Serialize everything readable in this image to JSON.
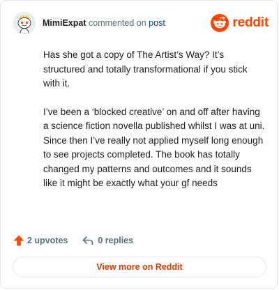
{
  "header": {
    "username": "MimiExpat",
    "action_text": "commented on",
    "post_link": "post",
    "logo_wordmark": "reddit"
  },
  "comment": {
    "paragraphs": [
      "Has she got a copy of The Artist’s Way? It’s structured and totally transformational if you stick with it.",
      "I’ve been a ‘blocked creative’ on and off after having a science fiction novella published whilst I was at uni. Since then I’ve really not applied myself long enough to see projects completed. The book has totally changed my patterns and outcomes and it sounds like it might be exactly what your gf needs"
    ]
  },
  "stats": {
    "upvotes_label": "2 upvotes",
    "replies_label": "0 replies"
  },
  "footer": {
    "view_more_label": "View more on Reddit"
  },
  "icons": {
    "avatar": "snoo-avatar-icon",
    "logo": "reddit-logo-icon",
    "upvote": "upvote-arrow-icon",
    "reply": "reply-arrow-icon"
  },
  "colors": {
    "brand": "#ff4500",
    "link": "#0a4496",
    "muted": "#576f76",
    "text": "#1c1c1c",
    "view_more": "#d93a00",
    "border": "#e4e6e8"
  }
}
